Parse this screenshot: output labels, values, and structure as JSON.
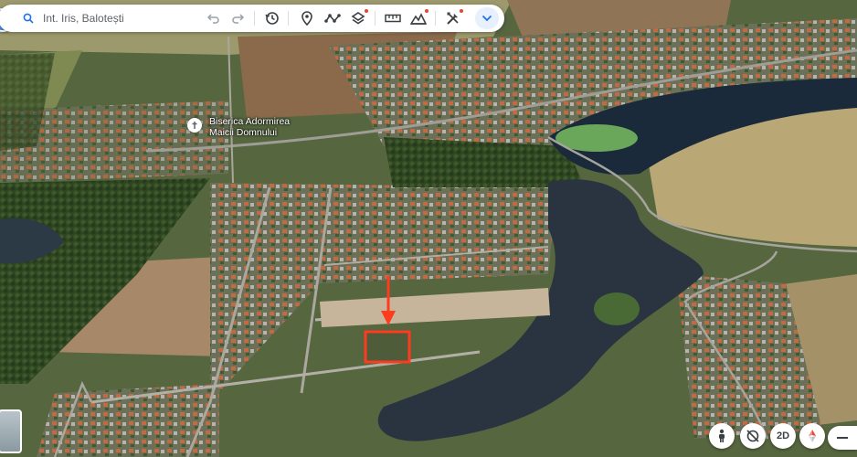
{
  "search": {
    "value": "Int. Iris, Balotești"
  },
  "toolbar": {
    "buttons": [
      {
        "name": "undo-button",
        "icon": "undo-icon"
      },
      {
        "name": "redo-button",
        "icon": "redo-icon"
      },
      {
        "name": "history-button",
        "icon": "history-icon"
      },
      {
        "name": "placemark-button",
        "icon": "location-pin-icon"
      },
      {
        "name": "path-button",
        "icon": "path-icon"
      },
      {
        "name": "layers-button",
        "icon": "layers-icon"
      },
      {
        "name": "ruler-button",
        "icon": "ruler-icon"
      },
      {
        "name": "terrain-button",
        "icon": "terrain-icon"
      },
      {
        "name": "tools-button",
        "icon": "tools-icon"
      },
      {
        "name": "more-button",
        "icon": "chevron-down-icon"
      }
    ]
  },
  "map_label": {
    "line1": "Biserica Adormirea",
    "line2": "Maicii Domnului"
  },
  "controls": {
    "view_2d": "2D"
  },
  "colors": {
    "marker": "#ff3b1f",
    "accent": "#1a73e8"
  }
}
